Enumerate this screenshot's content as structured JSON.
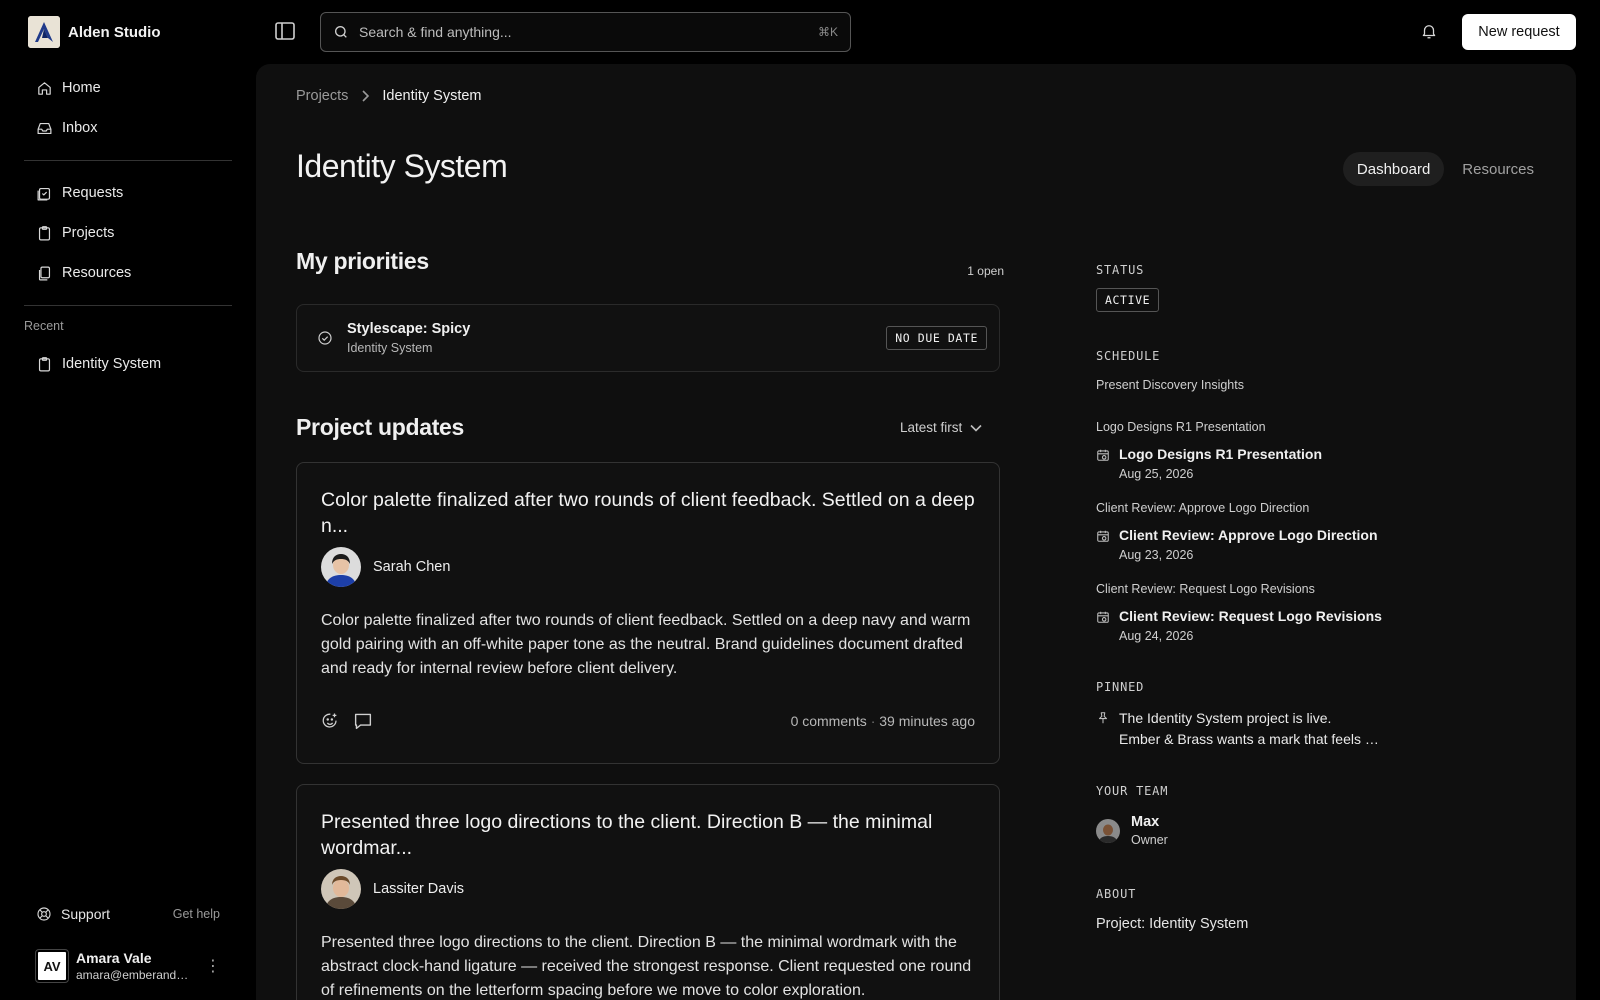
{
  "brand": {
    "name": "Alden Studio"
  },
  "sidebar": {
    "primary": [
      {
        "label": "Home",
        "icon": "home-icon"
      },
      {
        "label": "Inbox",
        "icon": "inbox-icon"
      }
    ],
    "secondary": [
      {
        "label": "Requests",
        "icon": "requests-icon"
      },
      {
        "label": "Projects",
        "icon": "clipboard-icon"
      },
      {
        "label": "Resources",
        "icon": "resources-icon"
      }
    ],
    "recent_label": "Recent",
    "recent": [
      {
        "label": "Identity System",
        "icon": "clipboard-icon"
      }
    ],
    "support_label": "Support",
    "get_help_label": "Get help",
    "user": {
      "initials": "AV",
      "name": "Amara Vale",
      "email": "amara@emberandbrass.com"
    }
  },
  "topbar": {
    "search_placeholder": "Search & find anything...",
    "search_shortcut": "⌘K",
    "new_request_label": "New request"
  },
  "main": {
    "breadcrumb": {
      "parent": "Projects",
      "current": "Identity System"
    },
    "title": "Identity System",
    "tabs": [
      {
        "label": "Dashboard",
        "active": true
      },
      {
        "label": "Resources",
        "active": false
      }
    ],
    "priorities": {
      "heading": "My priorities",
      "count_label": "1 open",
      "items": [
        {
          "title": "Stylescape: Spicy",
          "project": "Identity System",
          "due": "NO DUE DATE"
        }
      ]
    },
    "updates": {
      "heading": "Project updates",
      "sort_label": "Latest first",
      "items": [
        {
          "title": "Color palette finalized after two rounds of client feedback. Settled on a deep n...",
          "author": "Sarah Chen",
          "body": "Color palette finalized after two rounds of client feedback. Settled on a deep navy and warm gold pairing with an off-white paper tone as the neutral. Brand guidelines document drafted and ready for internal review before client delivery.",
          "comments": "0 comments",
          "time": "39 minutes ago"
        },
        {
          "title": "Presented three logo directions to the client. Direction B — the minimal wordmar...",
          "author": "Lassiter Davis",
          "body": "Presented three logo directions to the client. Direction B — the minimal wordmark with the abstract clock-hand ligature — received the strongest response. Client requested one round of refinements on the letterform spacing before we move to color exploration.",
          "comments": "",
          "time": ""
        }
      ]
    }
  },
  "rail": {
    "status_label": "STATUS",
    "status_value": "ACTIVE",
    "schedule_label": "SCHEDULE",
    "schedule_first": "Present Discovery Insights",
    "schedule": [
      {
        "group": "Logo Designs R1 Presentation",
        "title": "Logo Designs R1 Presentation",
        "date": "Aug 25, 2026"
      },
      {
        "group": "Client Review: Approve Logo Direction",
        "title": "Client Review: Approve Logo Direction",
        "date": "Aug 23, 2026"
      },
      {
        "group": "Client Review: Request Logo Revisions",
        "title": "Client Review: Request Logo Revisions",
        "date": "Aug 24, 2026"
      }
    ],
    "pinned_label": "PINNED",
    "pinned_line1": "The Identity System project is live.",
    "pinned_line2": "Ember & Brass wants a mark that feels timeless and warm.",
    "team_label": "YOUR TEAM",
    "team": [
      {
        "name": "Max",
        "role": "Owner"
      }
    ],
    "about_label": "ABOUT",
    "about_text": "Project: Identity System"
  },
  "colors": {
    "background": "#000000",
    "panel": "#0f0f0f",
    "card": "#111111",
    "accent": "#ffffff"
  }
}
